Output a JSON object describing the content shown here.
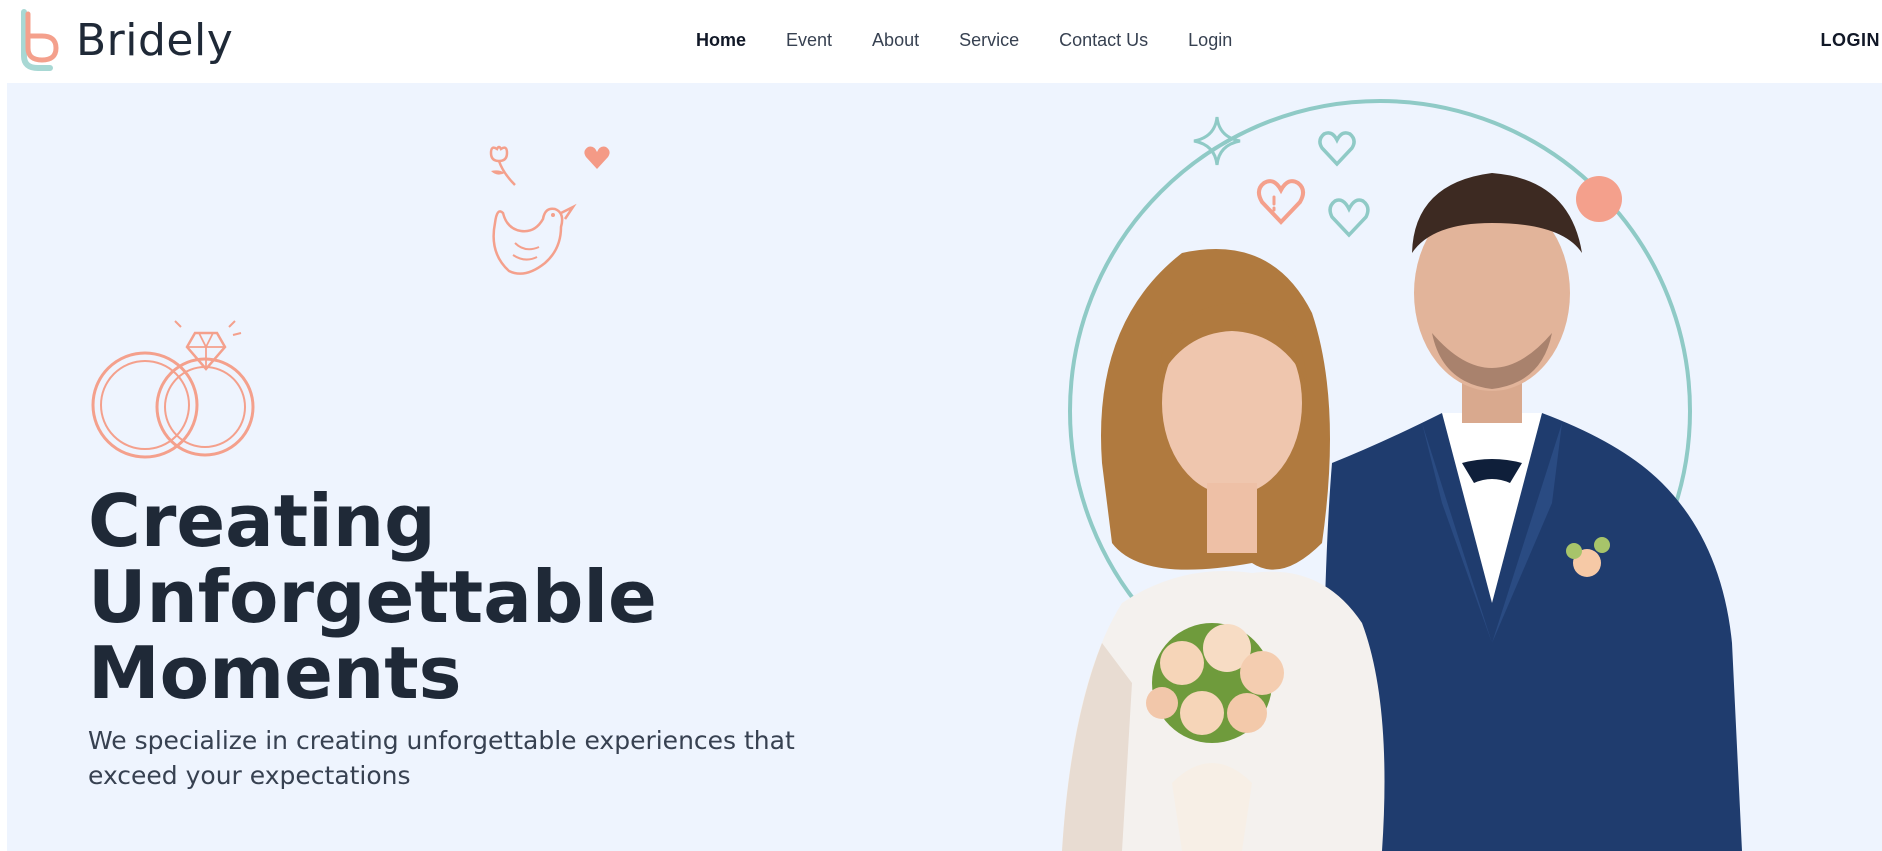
{
  "brand": {
    "name": "Bridely"
  },
  "nav": {
    "items": [
      {
        "label": "Home",
        "active": true
      },
      {
        "label": "Event",
        "active": false
      },
      {
        "label": "About",
        "active": false
      },
      {
        "label": "Service",
        "active": false
      },
      {
        "label": "Contact Us",
        "active": false
      },
      {
        "label": "Login",
        "active": false
      }
    ],
    "cta_label": "LOGIN"
  },
  "hero": {
    "title_lines": [
      "Creating",
      "Unforgettable",
      "Moments"
    ],
    "subtitle": "We specialize in creating unforgettable experiences that exceed your expectations"
  },
  "icons": {
    "logo": "b-logo-icon",
    "rings": "wedding-rings-icon",
    "bird": "dove-icon",
    "flower": "flower-icon",
    "hearts": "heart-icon",
    "sparkle": "sparkle-icon"
  },
  "colors": {
    "accent_coral": "#f4a08c",
    "accent_teal": "#8fcac6",
    "hero_bg": "#eef4fe",
    "text_dark": "#1f2937"
  }
}
